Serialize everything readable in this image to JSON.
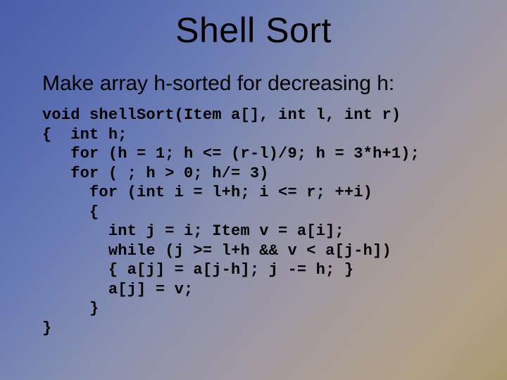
{
  "title": "Shell Sort",
  "subtitle": "Make array h-sorted for decreasing h:",
  "code": "void shellSort(Item a[], int l, int r)\n{  int h;\n   for (h = 1; h <= (r-l)/9; h = 3*h+1);\n   for ( ; h > 0; h/= 3)\n     for (int i = l+h; i <= r; ++i)\n     {\n       int j = i; Item v = a[i];\n       while (j >= l+h && v < a[j-h])\n       { a[j] = a[j-h]; j -= h; }\n       a[j] = v;\n     }\n}"
}
